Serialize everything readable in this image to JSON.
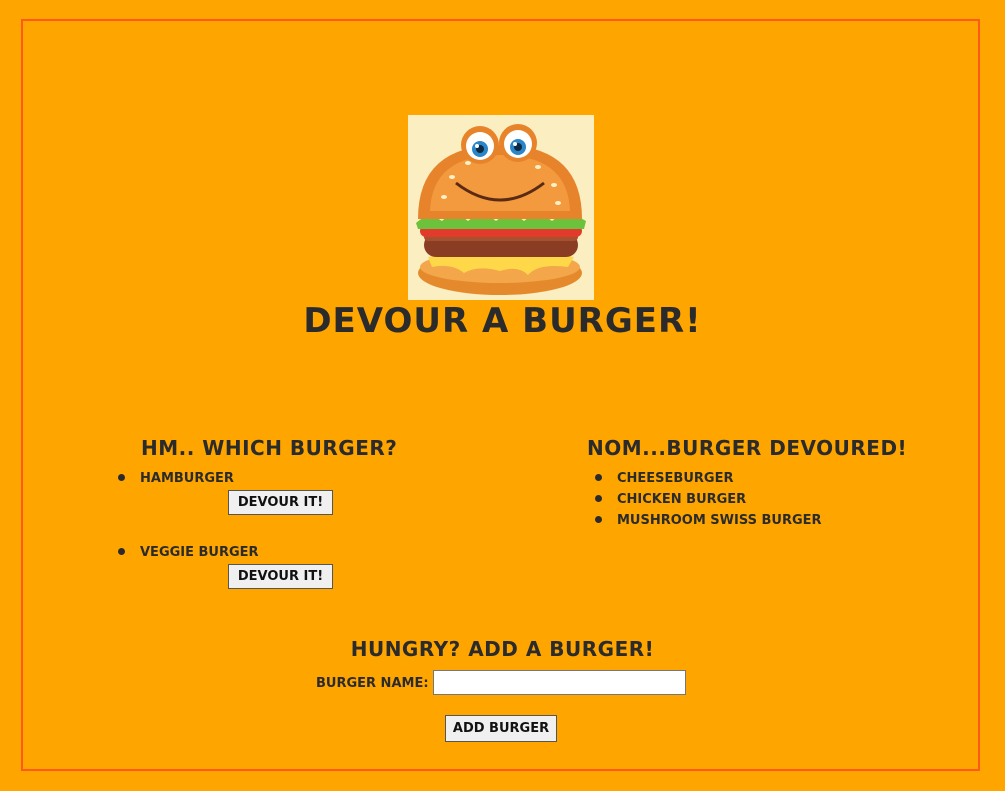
{
  "header": {
    "logo_icon": "burger-mascot-icon",
    "title": "Devour a Burger!"
  },
  "left_column": {
    "title": "Hm.. Which Burger?",
    "items": [
      {
        "name": "Hamburger",
        "button_label": "Devour it!"
      },
      {
        "name": "Veggie Burger",
        "button_label": "Devour it!"
      }
    ]
  },
  "right_column": {
    "title": "Nom...Burger Devoured!",
    "items": [
      {
        "name": "Cheeseburger"
      },
      {
        "name": "Chicken Burger"
      },
      {
        "name": "Mushroom Swiss Burger"
      }
    ]
  },
  "add_form": {
    "title": "Hungry? Add a Burger!",
    "name_label": "Burger Name:",
    "name_value": "",
    "name_placeholder": "",
    "submit_label": "Add Burger"
  },
  "colors": {
    "background": "#ffa500",
    "frame_border": "#ff5a1a",
    "text": "#2b2b2b"
  }
}
